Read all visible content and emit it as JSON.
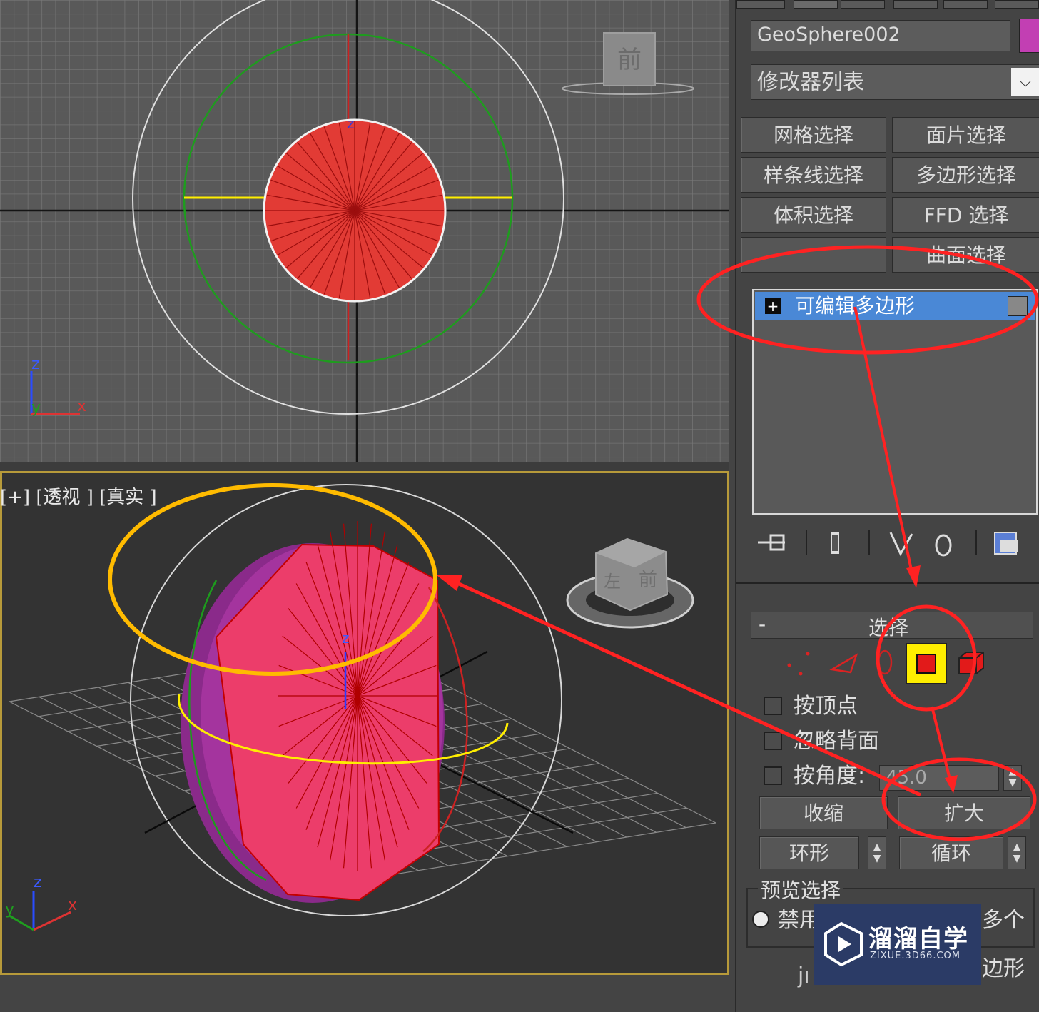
{
  "panel": {
    "object_name": "GeoSphere002",
    "object_color": "#c23fb3",
    "modifier_list": "修改器列表",
    "modifier_buttons": [
      "网格选择",
      "面片选择",
      "样条线选择",
      "多边形选择",
      "体积选择",
      "FFD 选择",
      "",
      "曲面选择"
    ],
    "stack_item": "可编辑多边形",
    "stack_item_plus": "+"
  },
  "viewports": {
    "persp_label": "[+] [透视 ] [真实 ]",
    "front_cube_label": "前",
    "persp_cube_labels": [
      "前",
      "左"
    ],
    "axis_labels": {
      "x": "x",
      "y": "y",
      "z": "z"
    }
  },
  "selection_rollout": {
    "title": "选择",
    "collapse": "-",
    "by_vertex": "按顶点",
    "ignore_backfacing": "忽略背面",
    "by_angle": "按角度:",
    "angle_value": "45.0",
    "shrink": "收缩",
    "grow": "扩大",
    "ring": "环形",
    "loop": "循环",
    "preview_group": "预览选择",
    "preview_disable": "禁用",
    "preview_multi": "多个",
    "preview_polygon_partial": "边形"
  },
  "watermark": {
    "title": "溜溜自学",
    "subtitle": "ZIXUE.3D66.COM",
    "partial_text": "jı"
  },
  "colors": {
    "annotation_red": "#ff2222",
    "annotation_orange": "#ffbb00",
    "selected_face": "#e8385a",
    "highlight": "#4a88d6",
    "viewport_border": "#b79a3a"
  }
}
